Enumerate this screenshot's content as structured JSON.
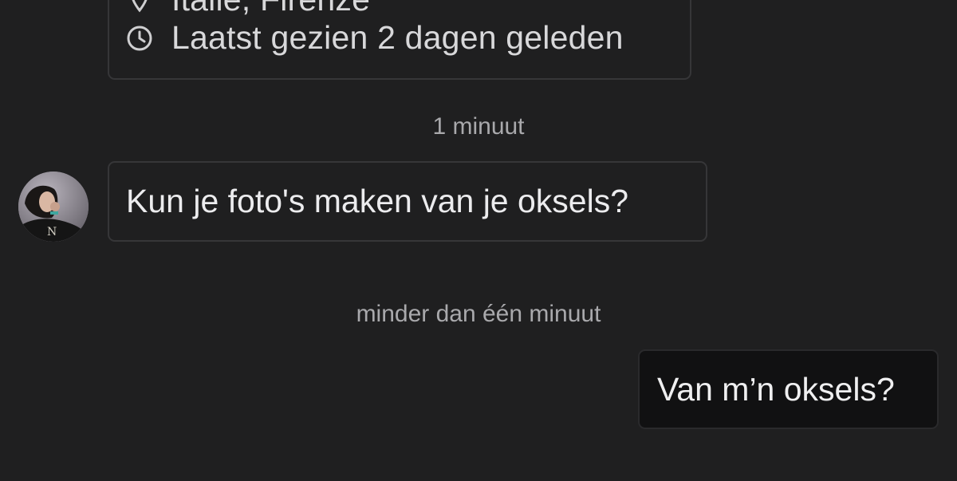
{
  "profile": {
    "location_text": "Italië, Firenze",
    "last_seen_text": "Laatst gezien 2 dagen geleden",
    "location_icon": "location-pin-icon",
    "last_seen_icon": "clock-icon"
  },
  "messages": [
    {
      "timestamp": "1 minuut",
      "direction": "incoming",
      "text": "Kun je foto's maken van je oksels?",
      "avatar": "contact-avatar"
    },
    {
      "timestamp": "minder dan één minuut",
      "direction": "outgoing",
      "text": "Van m’n oksels?"
    }
  ],
  "colors": {
    "background": "#1f1f20",
    "border": "#363638",
    "outgoing_bubble": "#111112",
    "muted_text": "#a9a9ac"
  }
}
